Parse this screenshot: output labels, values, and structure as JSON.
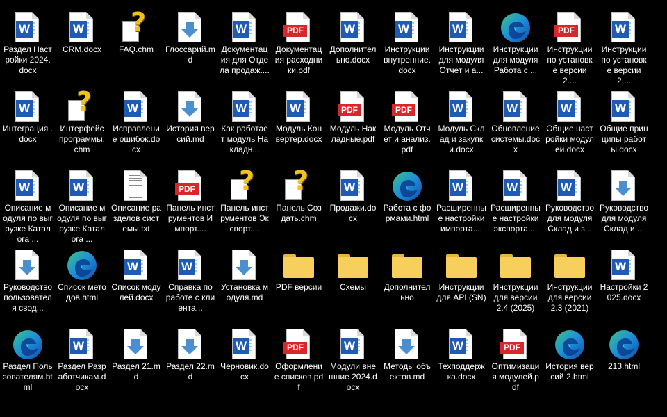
{
  "desktop_items": [
    {
      "label": "Раздел Настройки 2024.docx",
      "type": "word"
    },
    {
      "label": "CRM.docx",
      "type": "word"
    },
    {
      "label": "FAQ.chm",
      "type": "chm"
    },
    {
      "label": "Глоссарий.md",
      "type": "md"
    },
    {
      "label": "Документация для Отдела продаж....",
      "type": "word"
    },
    {
      "label": "Документация расходники.pdf",
      "type": "pdf"
    },
    {
      "label": "Дополнительно.docx",
      "type": "word"
    },
    {
      "label": "Инструкции внутренние.docx",
      "type": "word"
    },
    {
      "label": "Инструкции для модуля Отчет и а...",
      "type": "word"
    },
    {
      "label": "Инструкции для модуля Работа с ...",
      "type": "edge"
    },
    {
      "label": "Инструкции по установке версии 2....",
      "type": "pdf"
    },
    {
      "label": "Инструкции по установке версии 2....",
      "type": "word"
    },
    {
      "label": "Интеграция .docx",
      "type": "word"
    },
    {
      "label": "Интерфейс программы.chm",
      "type": "chm"
    },
    {
      "label": "Исправление ошибок.docx",
      "type": "word"
    },
    {
      "label": "История версий.md",
      "type": "md"
    },
    {
      "label": "Как работает модуль Накладн...",
      "type": "word"
    },
    {
      "label": "Модуль Конвертер.docx",
      "type": "word"
    },
    {
      "label": "Модуль Накладные.pdf",
      "type": "pdf"
    },
    {
      "label": "Модуль Отчет и анализ.pdf",
      "type": "pdf"
    },
    {
      "label": "Модуль Склад и закупки.docx",
      "type": "word"
    },
    {
      "label": "Обновление системы.docx",
      "type": "word"
    },
    {
      "label": "Общие настройки модулей.docx",
      "type": "word"
    },
    {
      "label": "Общие принципы работы.docx",
      "type": "word"
    },
    {
      "label": "Описание модуля по выгрузке Каталога ...",
      "type": "word"
    },
    {
      "label": "Описание модуля по выгрузке Каталога ...",
      "type": "word"
    },
    {
      "label": "Описание разделов системы.txt",
      "type": "txt"
    },
    {
      "label": "Панель инструментов Импорт....",
      "type": "pdf"
    },
    {
      "label": "Панель инструментов Экспорт....",
      "type": "chm"
    },
    {
      "label": "Панель Создать.chm",
      "type": "chm"
    },
    {
      "label": "Продажи.docx",
      "type": "word"
    },
    {
      "label": "Работа с формами.html",
      "type": "edge"
    },
    {
      "label": "Расширенные настройки импорта....",
      "type": "word"
    },
    {
      "label": "Расширенные настройки экспорта....",
      "type": "word"
    },
    {
      "label": "Руководство для модуля Склад и з...",
      "type": "word"
    },
    {
      "label": "Руководство для модуля Склад и ...",
      "type": "md"
    },
    {
      "label": "Руководство пользователя свод...",
      "type": "md"
    },
    {
      "label": "Список методов.html",
      "type": "edge"
    },
    {
      "label": "Список модулей.docx",
      "type": "word"
    },
    {
      "label": "Справка по работе с клиента...",
      "type": "word"
    },
    {
      "label": "Установка модуля.md",
      "type": "md"
    },
    {
      "label": "PDF версии",
      "type": "folder"
    },
    {
      "label": "Схемы",
      "type": "folder"
    },
    {
      "label": "Дополнительно",
      "type": "folder"
    },
    {
      "label": "Инструкции для API (SN)",
      "type": "folder"
    },
    {
      "label": "Инструкции для версии 2.4 (2025)",
      "type": "folder"
    },
    {
      "label": "Инструкции для версии 2.3 (2021)",
      "type": "folder"
    },
    {
      "label": "Настройки 2025.docx",
      "type": "word"
    },
    {
      "label": "Раздел Пользователям.html",
      "type": "edge"
    },
    {
      "label": "Раздел Разработчикам.docx",
      "type": "word"
    },
    {
      "label": "Раздел 21.md",
      "type": "md"
    },
    {
      "label": "Раздел 22.md",
      "type": "md"
    },
    {
      "label": "Черновик.docx",
      "type": "word"
    },
    {
      "label": "Оформление списков.pdf",
      "type": "pdf"
    },
    {
      "label": "Модули внешние 2024.docx",
      "type": "word"
    },
    {
      "label": "Методы объектов.md",
      "type": "md"
    },
    {
      "label": "Техподдержка.docx",
      "type": "word"
    },
    {
      "label": "Оптимизация модулей.pdf",
      "type": "pdf"
    },
    {
      "label": "История версий 2.html",
      "type": "edge"
    },
    {
      "label": "213.html",
      "type": "edge"
    }
  ],
  "icon_text": {
    "word": "W",
    "pdf": "PDF",
    "chm": "?"
  },
  "colors": {
    "background": "#000000",
    "word_blue": "#1f5bb5",
    "pdf_red": "#d9262b",
    "folder": "#f7cf5c",
    "md_arrow": "#4a8fd0",
    "chm_yellow": "#f2c21b"
  }
}
